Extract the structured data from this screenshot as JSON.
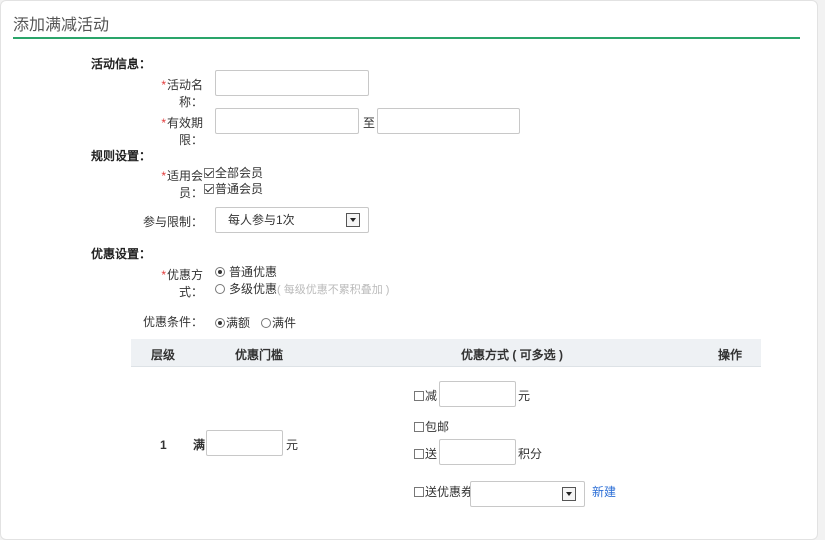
{
  "page": {
    "title": "添加满减活动"
  },
  "colors": {
    "accent": "#2aa56a",
    "required": "#e23b3b",
    "link": "#2d6fd6"
  },
  "info": {
    "heading": "活动信息：",
    "name_label": "活动名称：",
    "period_label": "有效期限：",
    "period_sep": "至"
  },
  "rules": {
    "heading": "规则设置：",
    "members_label": "适用会员：",
    "members": [
      {
        "label": "全部会员",
        "checked": true
      },
      {
        "label": "普通会员",
        "checked": true
      }
    ],
    "limit_label": "参与限制：",
    "limit_value": "每人参与1次"
  },
  "discount": {
    "heading": "优惠设置：",
    "method_label": "优惠方式：",
    "methods": [
      {
        "label": "普通优惠",
        "hint": "",
        "checked": true
      },
      {
        "label": "多级优惠",
        "hint": "( 每级优惠不累积叠加 )",
        "checked": false
      }
    ],
    "condition_label": "优惠条件：",
    "conditions": [
      {
        "label": "满额",
        "checked": true
      },
      {
        "label": "满件",
        "checked": false
      }
    ]
  },
  "table": {
    "headers": {
      "level": "层级",
      "threshold": "优惠门槛",
      "method": "优惠方式 ( 可多选 )",
      "action": "操作"
    },
    "row": {
      "level": "1",
      "threshold_prefix": "满",
      "threshold_unit": "元",
      "options": {
        "reduce": "减",
        "reduce_unit": "元",
        "free_shipping": "包邮",
        "give": "送",
        "give_unit": "积分",
        "coupon": "送优惠券",
        "coupon_new": "新建"
      }
    }
  }
}
